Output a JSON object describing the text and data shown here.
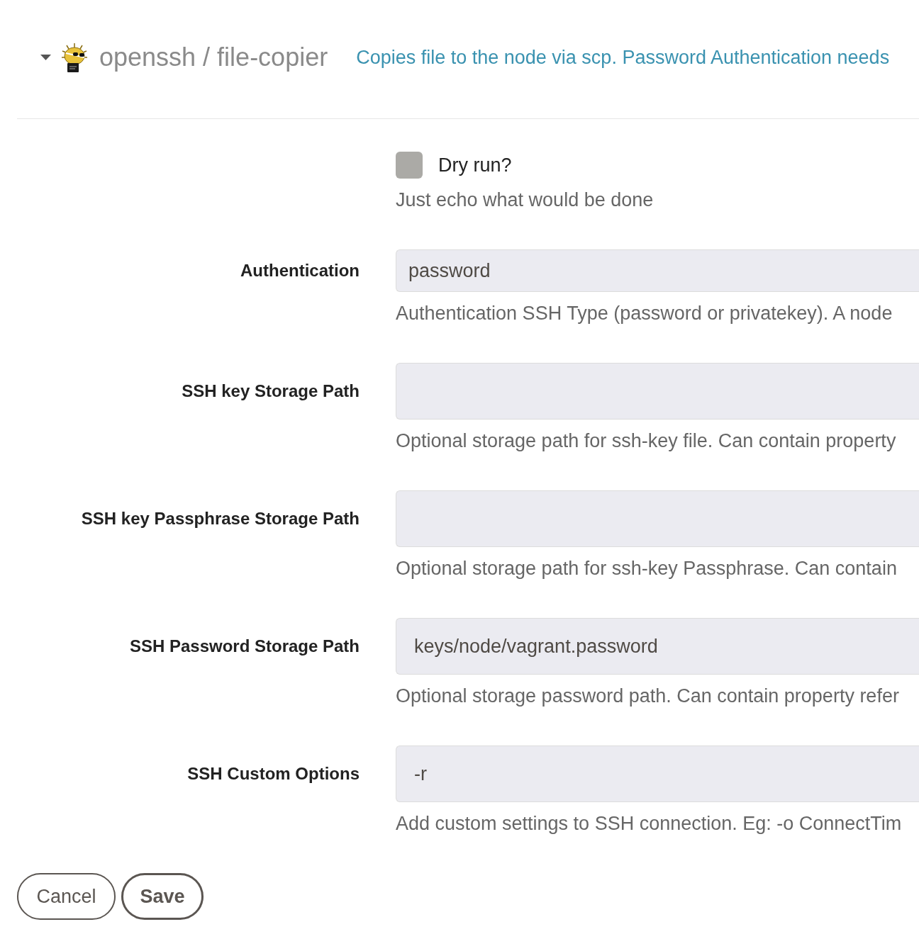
{
  "header": {
    "expanded": true,
    "title": "openssh / file-copier",
    "description": "Copies file to the node via scp. Password Authentication needs"
  },
  "fields": [
    {
      "kind": "checkbox",
      "label": "Dry run?",
      "checked": false,
      "help": "Just echo what would be done"
    },
    {
      "kind": "select",
      "label": "Authentication",
      "value": "password",
      "help": "Authentication SSH Type (password or privatekey). A node"
    },
    {
      "kind": "text",
      "label": "SSH key Storage Path",
      "help": "Optional storage path for ssh-key file. Can contain property"
    },
    {
      "kind": "text",
      "label": "SSH key Passphrase Storage Path",
      "help": "Optional storage path for ssh-key Passphrase. Can contain"
    },
    {
      "kind": "text",
      "label": "SSH Password Storage Path",
      "value": "keys/node/vagrant.password",
      "help": "Optional storage password path. Can contain property refer"
    },
    {
      "kind": "text",
      "label": "SSH Custom Options",
      "value": "-r",
      "help": "Add custom settings to SSH connection. Eg: -o ConnectTim"
    }
  ],
  "buttons": [
    {
      "kind": "secondary",
      "label": "Cancel"
    },
    {
      "kind": "primary",
      "label": "Save"
    }
  ]
}
